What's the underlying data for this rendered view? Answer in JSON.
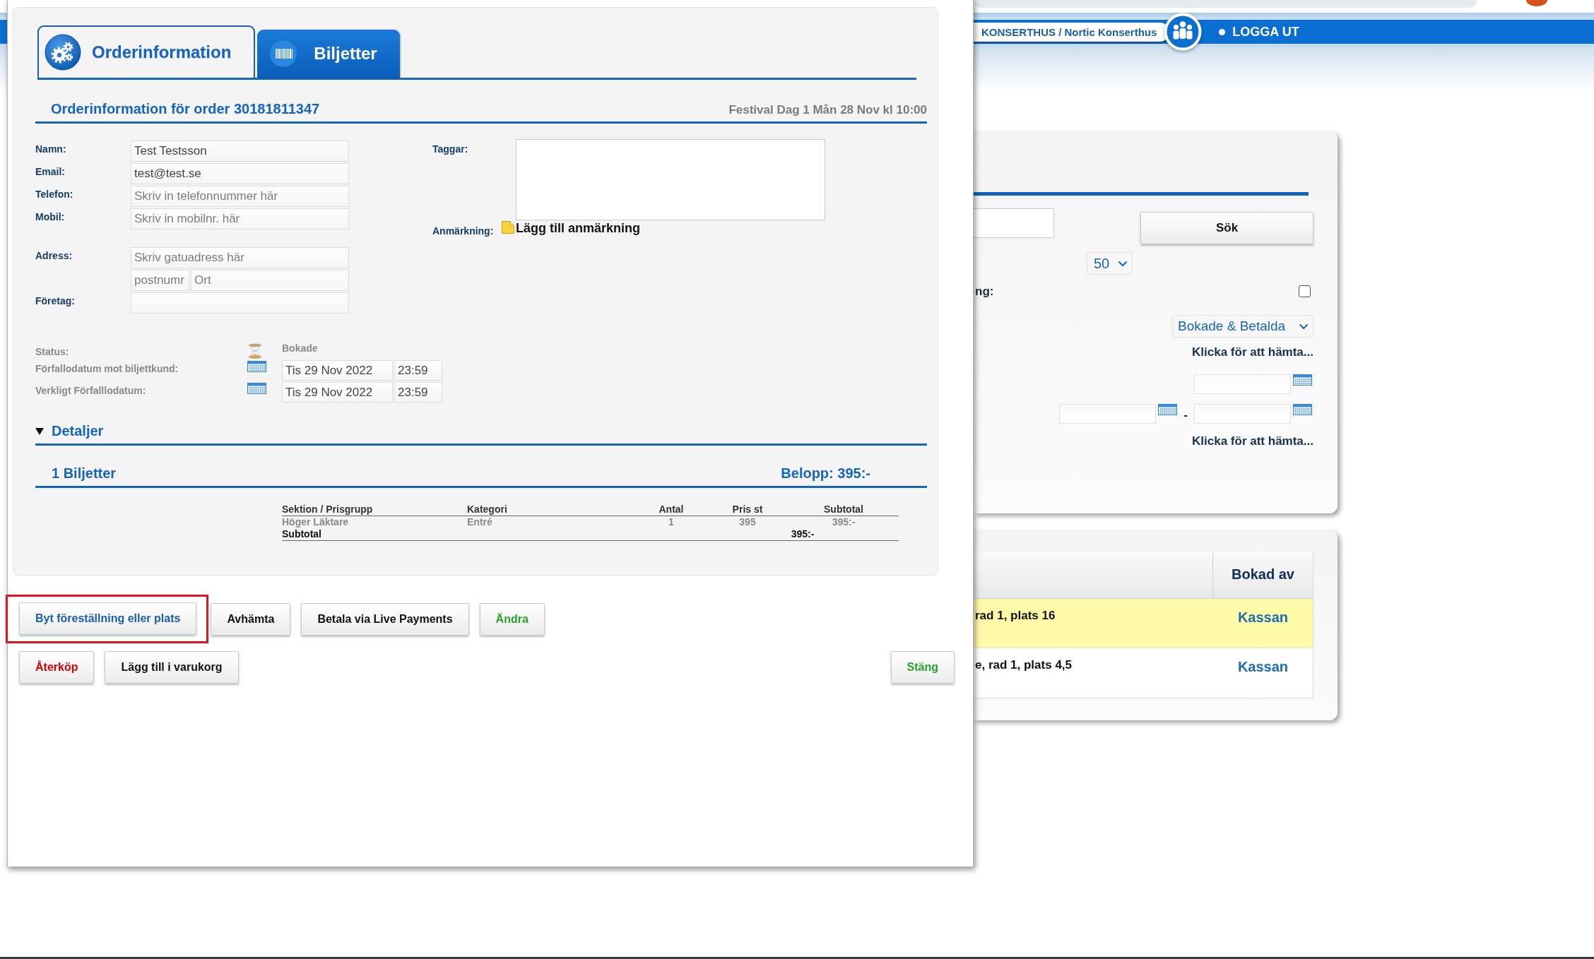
{
  "site_header": {
    "account": "KONSERTHUS / Nortic Konserthus",
    "logout": "LOGGA UT"
  },
  "search_panel": {
    "search_button": "Sök",
    "page_size": "50",
    "option_label": "ng:",
    "option_checked": false,
    "status_filter": "Bokade & Betalda",
    "fetch_links": [
      "Klicka för att hämta...",
      "Klicka för att hämta..."
    ],
    "date_separator": "-"
  },
  "bookings_table": {
    "columns": [
      "Bokad av"
    ],
    "rows": [
      {
        "column_1": "rad 1, plats 16",
        "booked_by": "Kassan",
        "highlighted": true
      },
      {
        "column_1": "e, rad 1, plats 4,5",
        "booked_by": "Kassan",
        "highlighted": false
      }
    ]
  },
  "order_dialog": {
    "tabs": [
      {
        "label": "Orderinformation",
        "selected": true
      },
      {
        "label": "Biljetter",
        "selected": false
      }
    ],
    "title": "Orderinformation för order 30181811347",
    "event": "Festival Dag 1 Mån 28 Nov kl 10:00",
    "contact_fields": [
      {
        "label": "Namn:",
        "value": "Test Testsson"
      },
      {
        "label": "Email:",
        "value": "test@test.se"
      },
      {
        "label": "Telefon:",
        "placeholder": "Skriv in telefonnummer här"
      },
      {
        "label": "Mobil:",
        "placeholder": "Skriv in mobilnr. här"
      }
    ],
    "address": {
      "label": "Adress:",
      "street": {
        "placeholder": "Skriv gatuadress här"
      },
      "postcode": {
        "placeholder": "postnumr"
      },
      "city": {
        "placeholder": "Ort"
      }
    },
    "company": {
      "label": "Företag:"
    },
    "tags": {
      "label": "Taggar:"
    },
    "remark": {
      "label": "Anmärkning:",
      "link": "Lägg till anmärkning"
    },
    "status": {
      "label": "Status:",
      "value": "Bokade"
    },
    "due_dates": [
      {
        "label": "Förfallodatum mot biljettkund:",
        "date": "Tis 29 Nov 2022",
        "time": "23:59"
      },
      {
        "label": "Verkligt Förfalllodatum:",
        "date": "Tis 29 Nov 2022",
        "time": "23:59"
      }
    ],
    "details": {
      "label": "Detaljer",
      "expanded": true
    },
    "tickets": {
      "title": "1 Biljetter",
      "amount": "Belopp: 395:-",
      "columns": [
        "Sektion / Prisgrupp",
        "Kategori",
        "Antal",
        "Pris st",
        "Subtotal"
      ],
      "rows": [
        [
          "Höger Läktare",
          "Entré",
          "1",
          "395",
          "395:-"
        ]
      ],
      "subtotal": {
        "label": "Subtotal",
        "value": "395:-"
      }
    },
    "action_rows": [
      {
        "buttons": [
          {
            "label": "Byt föreställning eller plats",
            "kind": "link",
            "highlighted": true
          },
          {
            "label": "Avhämta",
            "kind": "plain",
            "highlighted": false
          },
          {
            "label": "Betala via Live Payments",
            "kind": "plain",
            "highlighted": false
          },
          {
            "label": "Ändra",
            "kind": "confirm",
            "highlighted": false
          }
        ]
      },
      {
        "buttons": [
          {
            "label": "Återköp",
            "kind": "danger",
            "highlighted": false
          },
          {
            "label": "Lägg till i varukorg",
            "kind": "plain",
            "highlighted": false
          }
        ]
      }
    ],
    "close_button": {
      "label": "Stäng",
      "kind": "confirm"
    }
  }
}
